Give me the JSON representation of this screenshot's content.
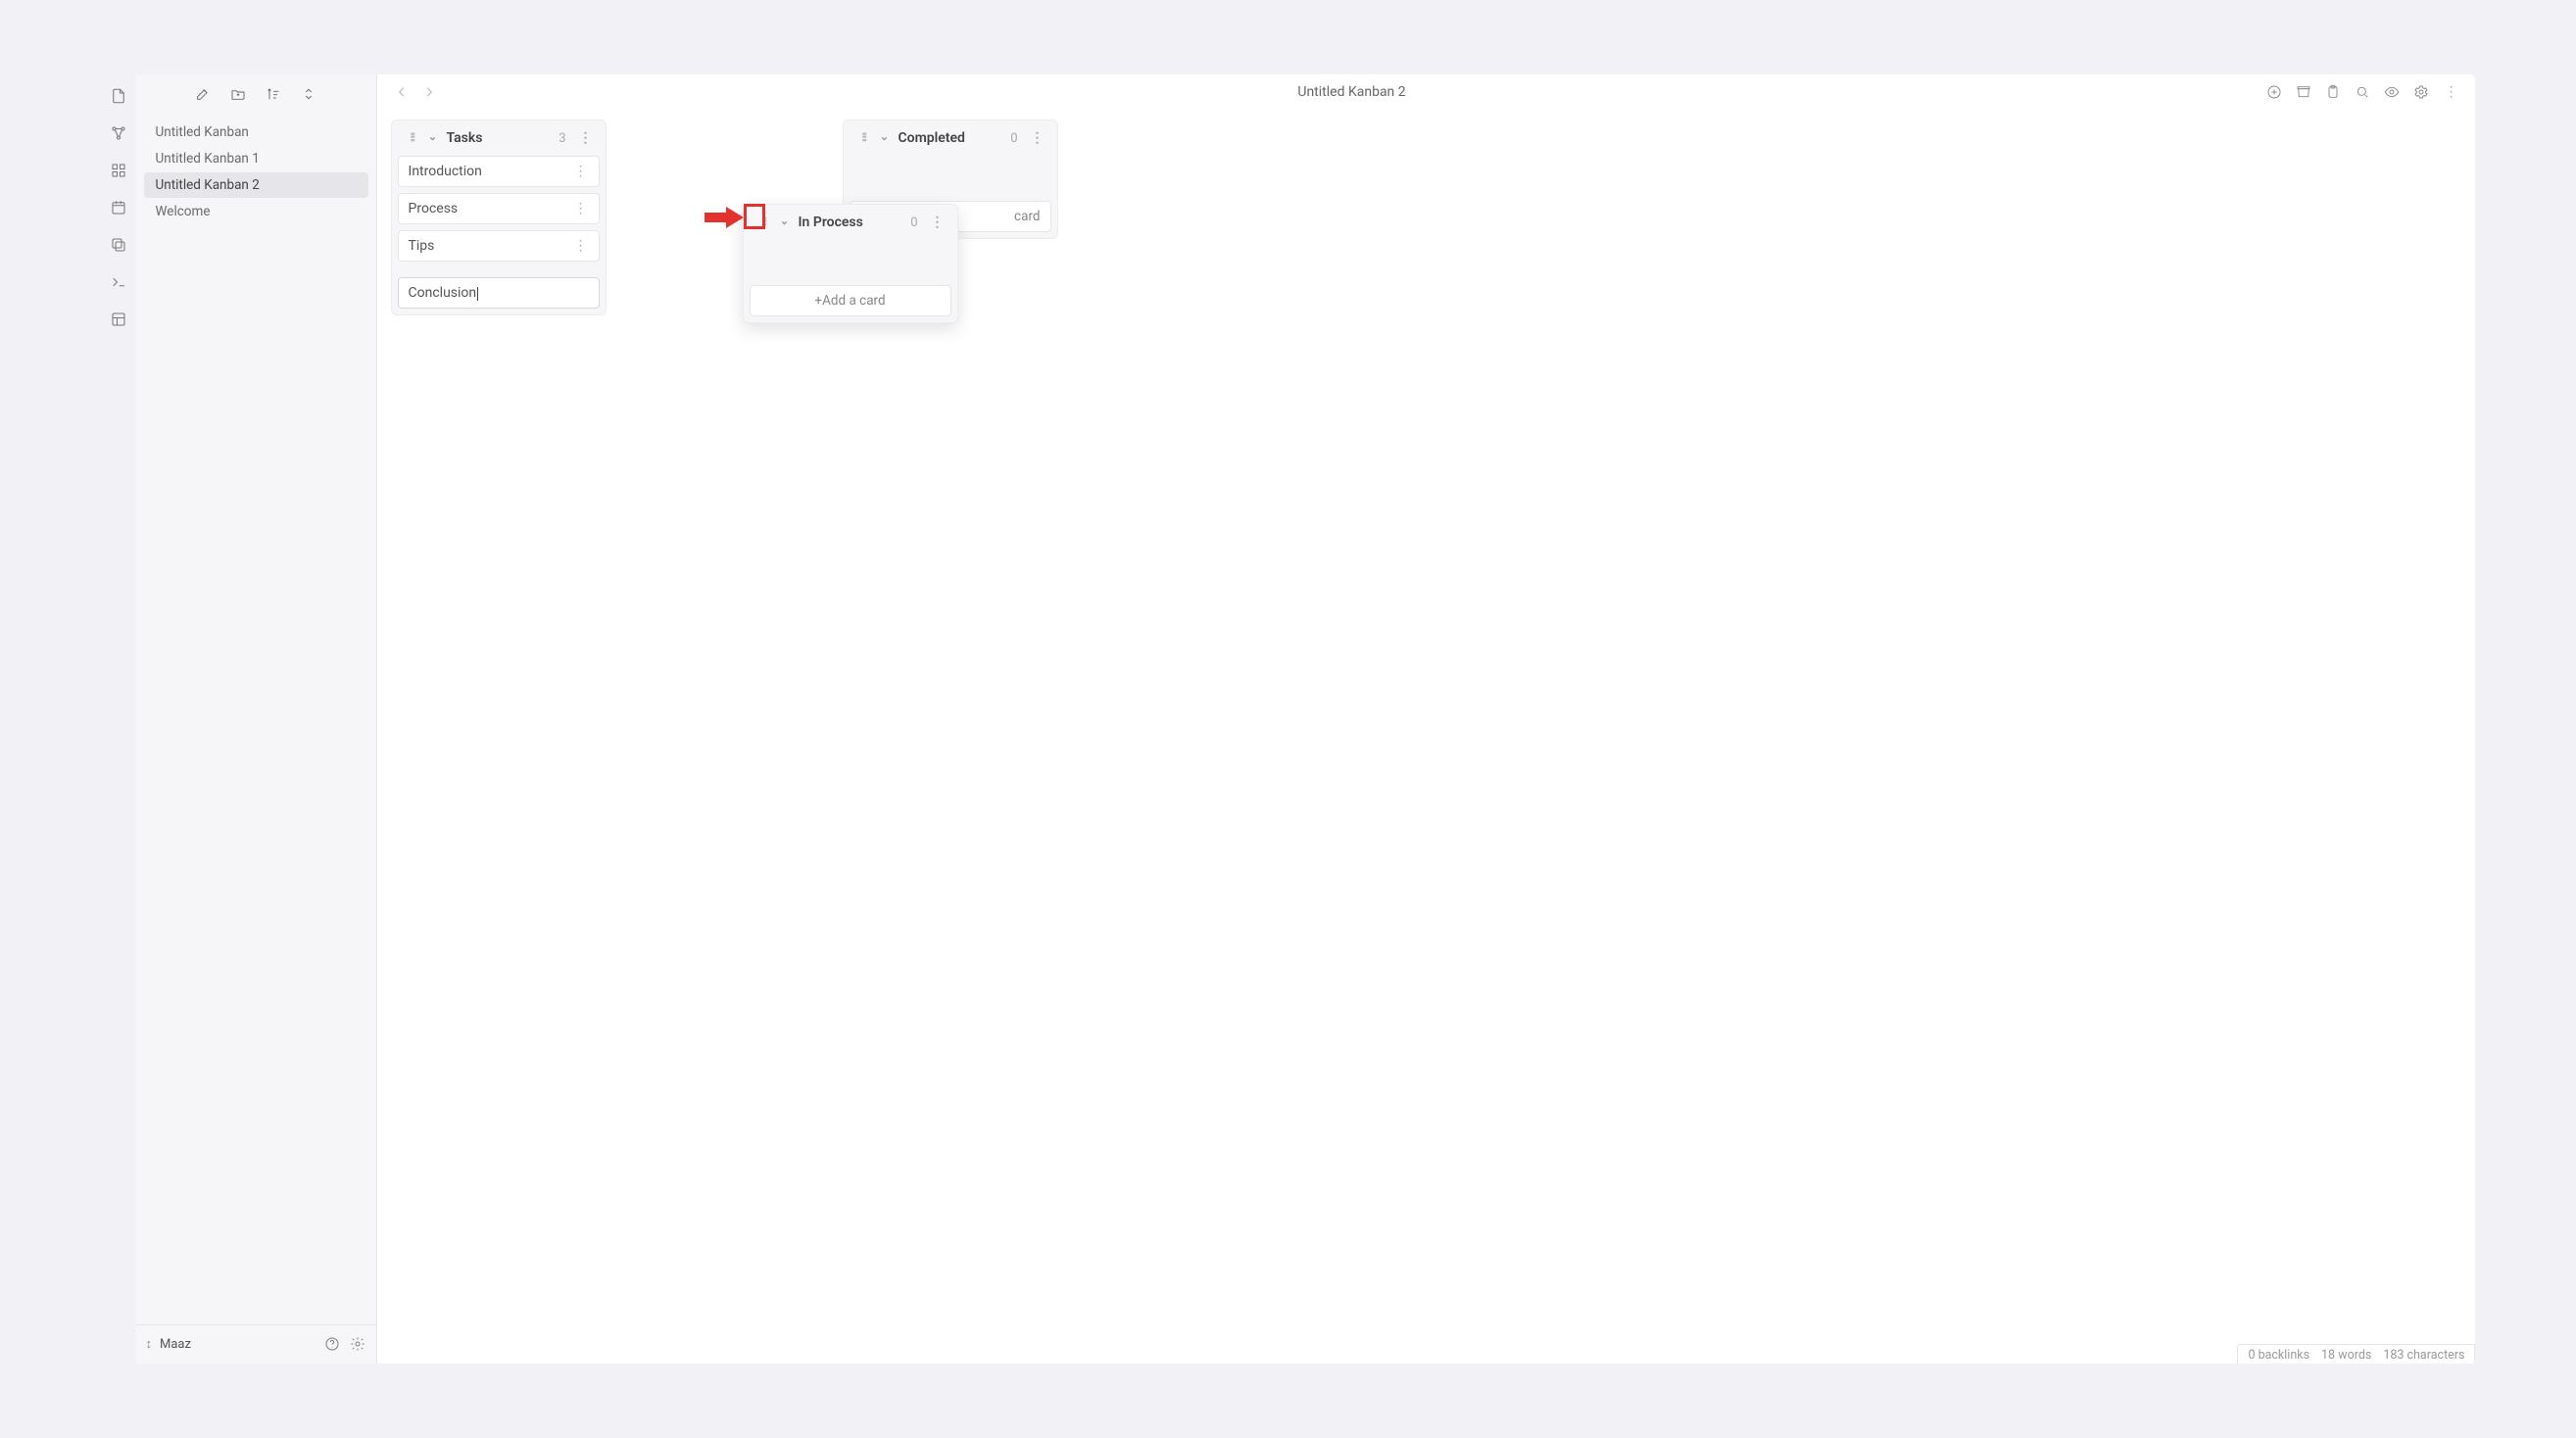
{
  "sidebar": {
    "pages": [
      {
        "label": "Untitled Kanban",
        "active": false
      },
      {
        "label": "Untitled Kanban 1",
        "active": false
      },
      {
        "label": "Untitled Kanban 2",
        "active": true
      },
      {
        "label": "Welcome",
        "active": false
      }
    ],
    "user": "Maaz"
  },
  "header": {
    "title": "Untitled Kanban 2"
  },
  "board": {
    "columns": {
      "tasks": {
        "title": "Tasks",
        "count": "3",
        "cards": [
          {
            "title": "Introduction"
          },
          {
            "title": "Process"
          },
          {
            "title": "Tips"
          }
        ],
        "editing_card": "Conclusion"
      },
      "in_process": {
        "title": "In Process",
        "count": "0",
        "add_label": "+Add a card"
      },
      "completed": {
        "title": "Completed",
        "count": "0",
        "partial_add_visible_text": "card"
      }
    }
  },
  "status": {
    "backlinks": "0 backlinks",
    "words": "18 words",
    "characters": "183 characters"
  },
  "annotation": {
    "arrow_color": "#e3322e",
    "highlight_target": "in-process-drag-handle"
  }
}
